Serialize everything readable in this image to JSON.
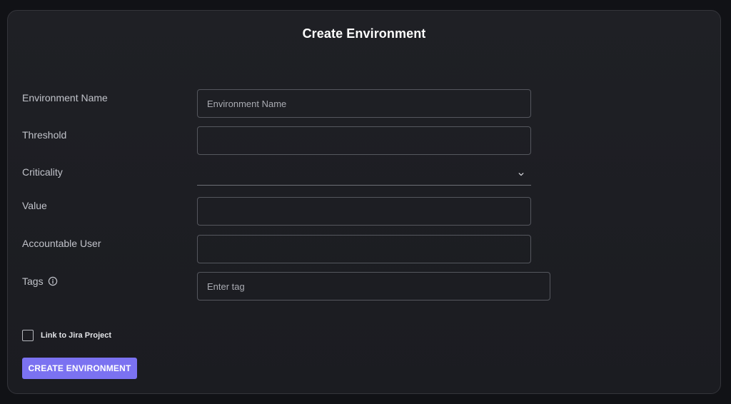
{
  "form": {
    "title": "Create Environment",
    "fields": {
      "environment_name": {
        "label": "Environment Name",
        "placeholder": "Environment Name",
        "value": ""
      },
      "threshold": {
        "label": "Threshold",
        "value": ""
      },
      "criticality": {
        "label": "Criticality",
        "selected": ""
      },
      "value": {
        "label": "Value",
        "value": ""
      },
      "accountable_user": {
        "label": "Accountable User",
        "value": ""
      },
      "tags": {
        "label": "Tags",
        "placeholder": "Enter tag",
        "value": ""
      }
    },
    "jira_link": {
      "label": "Link to Jira Project",
      "checked": false
    },
    "submit_label": "CREATE ENVIRONMENT"
  },
  "icons": {
    "tags_info": "info-icon",
    "criticality_dropdown": "chevron-down-icon"
  },
  "colors": {
    "accent": "#7b72f1",
    "background": "#111216",
    "panel": "#1f2025"
  }
}
